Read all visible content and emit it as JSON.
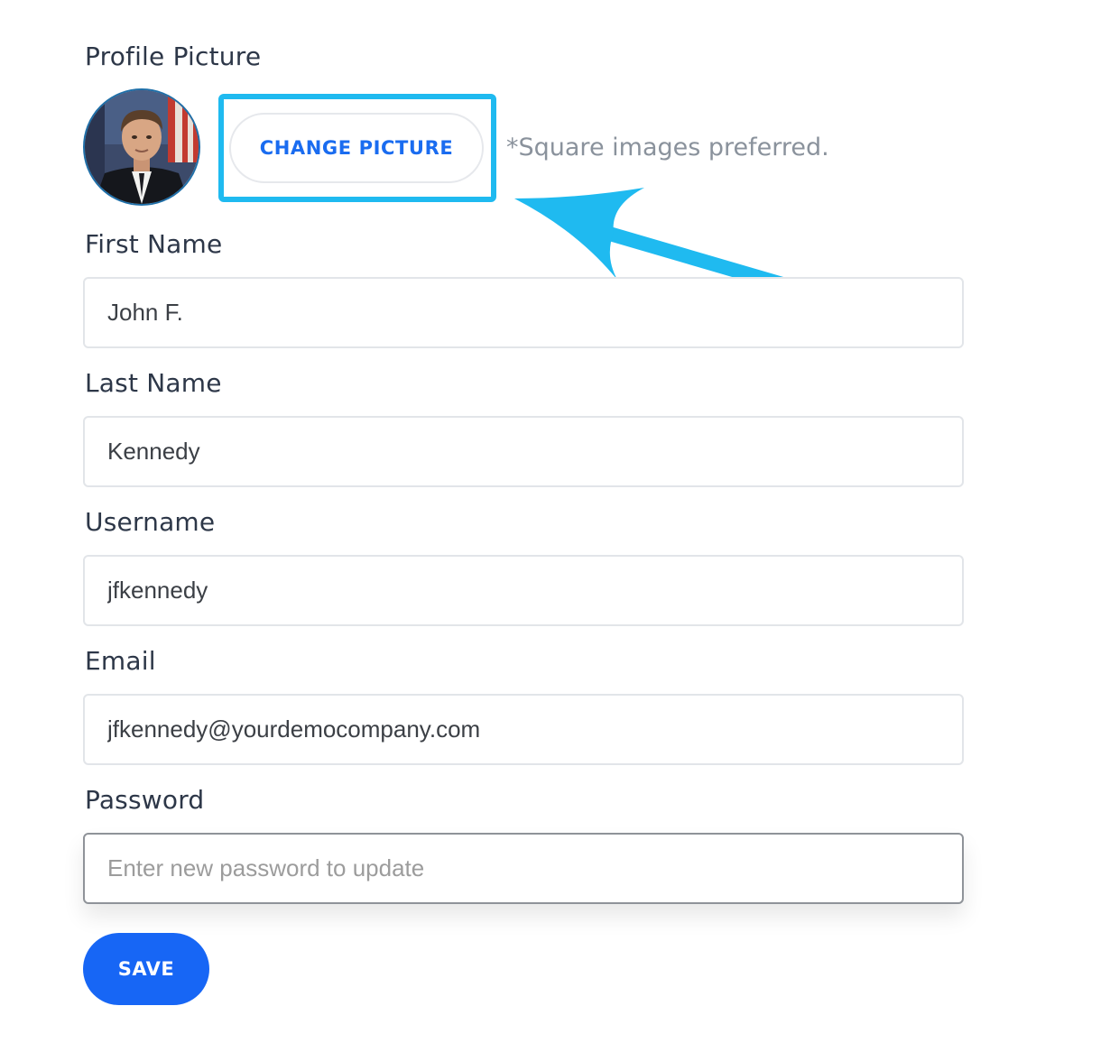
{
  "profile_picture": {
    "label": "Profile Picture",
    "change_button_label": "CHANGE PICTURE",
    "hint": "*Square images preferred."
  },
  "fields": {
    "first_name": {
      "label": "First Name",
      "value": "John F."
    },
    "last_name": {
      "label": "Last Name",
      "value": "Kennedy"
    },
    "username": {
      "label": "Username",
      "value": "jfkennedy"
    },
    "email": {
      "label": "Email",
      "value": "jfkennedy@yourdemocompany.com"
    },
    "password": {
      "label": "Password",
      "value": "",
      "placeholder": "Enter new password to update"
    }
  },
  "save_label": "SAVE",
  "colors": {
    "accent": "#1766f5",
    "annotation": "#1fbaf0",
    "label_text": "#2d3748",
    "hint_text": "#8a929c"
  }
}
